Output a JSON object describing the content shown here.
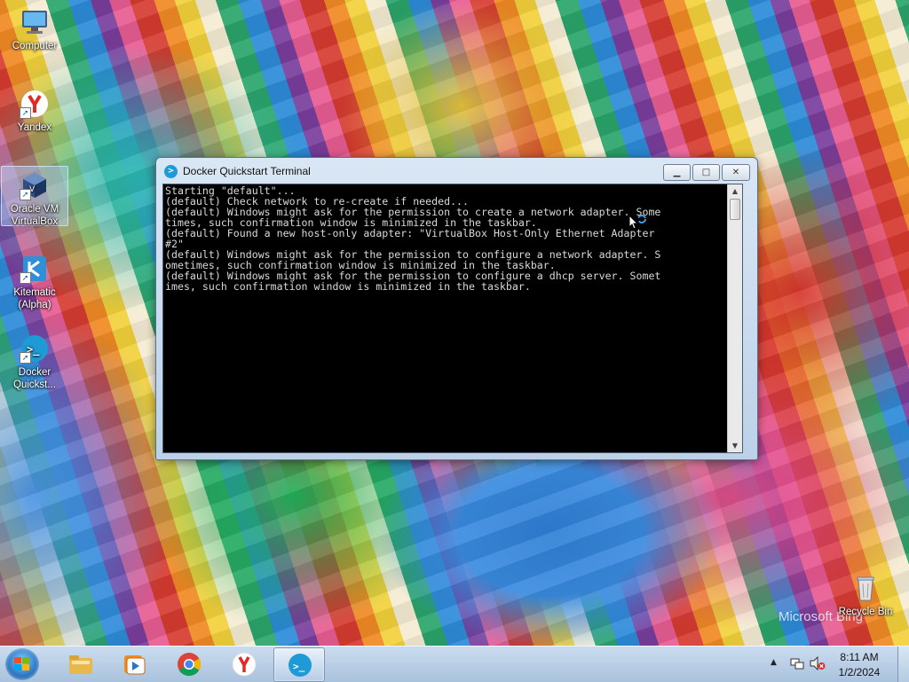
{
  "desktop": {
    "icons": [
      {
        "label": "Computer",
        "icon": "computer-icon"
      },
      {
        "label": "Yandex",
        "icon": "yandex-icon"
      },
      {
        "label": "Oracle VM VirtualBox",
        "icon": "virtualbox-icon"
      },
      {
        "label": "Kitematic (Alpha)",
        "icon": "kitematic-icon"
      },
      {
        "label": "Docker Quickst...",
        "icon": "docker-icon"
      },
      {
        "label": "Recycle Bin",
        "icon": "recycle-bin-icon"
      }
    ],
    "watermark": "Microsoft Bing"
  },
  "window": {
    "title": "Docker Quickstart Terminal",
    "console_lines": [
      "Starting \"default\"...",
      "(default) Check network to re-create if needed...",
      "(default) Windows might ask for the permission to create a network adapter. Some",
      "times, such confirmation window is minimized in the taskbar.",
      "(default) Found a new host-only adapter: \"VirtualBox Host-Only Ethernet Adapter",
      "#2\"",
      "(default) Windows might ask for the permission to configure a network adapter. S",
      "ometimes, such confirmation window is minimized in the taskbar.",
      "(default) Windows might ask for the permission to configure a dhcp server. Somet",
      "imes, such confirmation window is minimized in the taskbar."
    ]
  },
  "taskbar": {
    "items": [
      "start-button",
      "file-explorer",
      "media-player",
      "chrome",
      "yandex-browser",
      "docker-quickstart-terminal"
    ],
    "active_item": "docker-quickstart-terminal",
    "clock": {
      "time": "8:11 AM",
      "date": "1/2/2024"
    }
  },
  "colors": {
    "console_background": "#000000",
    "console_text": "#d9d9d9",
    "docker_blue": "#1e9ad6",
    "taskbar": "#b9cfe6"
  }
}
